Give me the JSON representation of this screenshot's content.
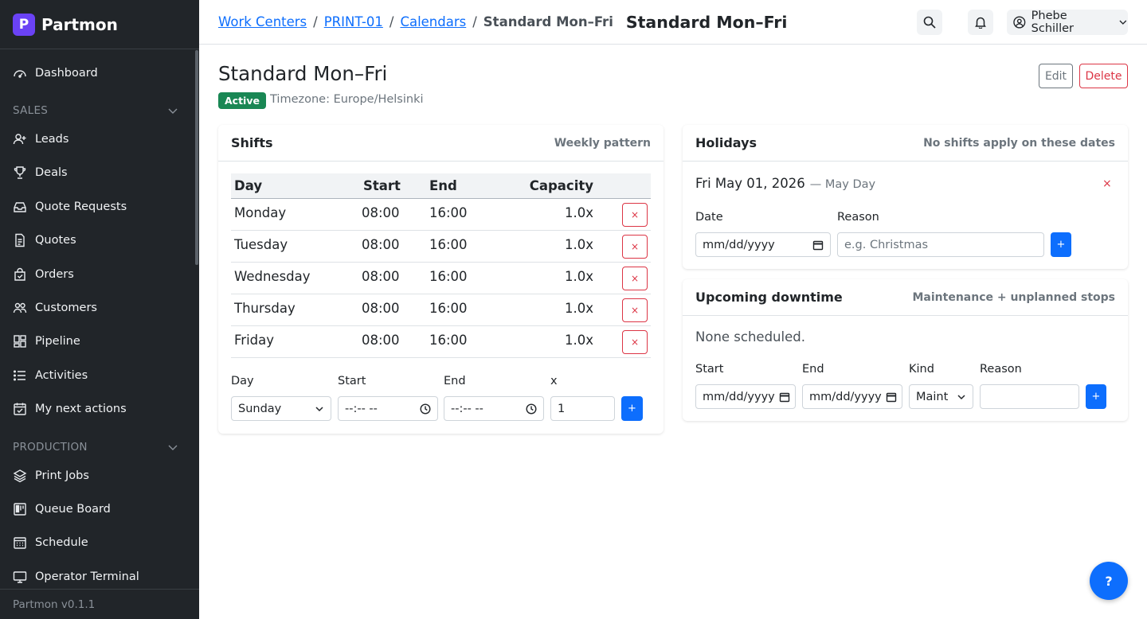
{
  "brand": {
    "initial": "P",
    "name": "Partmon",
    "version": "Partmon v0.1.1"
  },
  "sidebar": {
    "dashboard": "Dashboard",
    "sales_section": "SALES",
    "sales": [
      "Leads",
      "Deals",
      "Quote Requests",
      "Quotes",
      "Orders",
      "Customers",
      "Pipeline",
      "Activities",
      "My next actions"
    ],
    "production_section": "PRODUCTION",
    "production": [
      "Print Jobs",
      "Queue Board",
      "Schedule",
      "Operator Terminal"
    ]
  },
  "breadcrumb": {
    "items": [
      "Work Centers",
      "PRINT-01",
      "Calendars"
    ],
    "separator": "/",
    "current": "Standard Mon–Fri"
  },
  "header": {
    "title": "Standard Mon–Fri",
    "user_name": "Phebe Schiller"
  },
  "page": {
    "title": "Standard Mon–Fri",
    "status": "Active",
    "timezone": "Timezone: Europe/Helsinki",
    "edit_label": "Edit",
    "delete_label": "Delete"
  },
  "shifts": {
    "title": "Shifts",
    "subtitle": "Weekly pattern",
    "columns": [
      "Day",
      "Start",
      "End",
      "Capacity"
    ],
    "rows": [
      {
        "day": "Monday",
        "start": "08:00",
        "end": "16:00",
        "capacity": "1.0x"
      },
      {
        "day": "Tuesday",
        "start": "08:00",
        "end": "16:00",
        "capacity": "1.0x"
      },
      {
        "day": "Wednesday",
        "start": "08:00",
        "end": "16:00",
        "capacity": "1.0x"
      },
      {
        "day": "Thursday",
        "start": "08:00",
        "end": "16:00",
        "capacity": "1.0x"
      },
      {
        "day": "Friday",
        "start": "08:00",
        "end": "16:00",
        "capacity": "1.0x"
      }
    ],
    "remove_label": "×",
    "form": {
      "day_label": "Day",
      "start_label": "Start",
      "end_label": "End",
      "x_label": "x",
      "day_value": "Sunday",
      "time_placeholder": "--:-- --",
      "x_value": "1",
      "add_label": "+"
    }
  },
  "holidays": {
    "title": "Holidays",
    "subtitle": "No shifts apply on these dates",
    "entry_date": "Fri May 01, 2026",
    "entry_name": "— May Day",
    "remove_label": "×",
    "form": {
      "date_label": "Date",
      "reason_label": "Reason",
      "date_placeholder": "mm/dd/yyyy",
      "reason_placeholder": "e.g. Christmas",
      "add_label": "+"
    }
  },
  "downtime": {
    "title": "Upcoming downtime",
    "subtitle": "Maintenance + unplanned stops",
    "empty": "None scheduled.",
    "form": {
      "start_label": "Start",
      "end_label": "End",
      "kind_label": "Kind",
      "reason_label": "Reason",
      "date_placeholder": "mm/dd/yyyy, --:-- --",
      "kind_value": "Maintenance",
      "add_label": "+"
    }
  },
  "help_label": "?",
  "colors": {
    "sidebar_bg": "#212529",
    "brand_accent": "#6a42f5",
    "primary": "#0d6efd",
    "danger": "#dc3545",
    "success": "#198754"
  },
  "icons": [
    "dashboard-icon",
    "user-plus-icon",
    "trophy-icon",
    "inbox-icon",
    "file-icon",
    "bag-icon",
    "people-icon",
    "grid-icon",
    "list-icon",
    "calendar-check-icon",
    "layers-icon",
    "board-icon",
    "calendar-icon",
    "monitor-icon",
    "search-icon",
    "bell-icon",
    "user-circle-icon",
    "chevron-down-icon"
  ]
}
